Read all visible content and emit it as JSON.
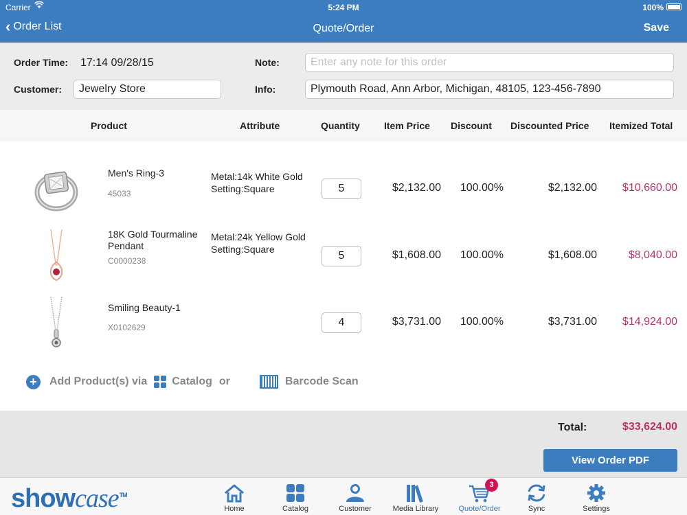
{
  "status_bar": {
    "carrier": "Carrier",
    "time": "5:24 PM",
    "battery": "100%"
  },
  "nav": {
    "back_label": "Order List",
    "title": "Quote/Order",
    "save_label": "Save"
  },
  "form": {
    "order_time_label": "Order Time:",
    "order_time_value": "17:14 09/28/15",
    "note_label": "Note:",
    "note_placeholder": "Enter any note for this order",
    "customer_label": "Customer:",
    "customer_value": "Jewelry Store",
    "info_label": "Info:",
    "info_value": "Plymouth Road, Ann Arbor, Michigan, 48105, 123-456-7890"
  },
  "table": {
    "headers": [
      "Product",
      "Attribute",
      "Quantity",
      "Item Price",
      "Discount",
      "Discounted Price",
      "Itemized Total"
    ],
    "rows": [
      {
        "name": "Men's Ring-3",
        "sku": "45033",
        "attr": "Metal:14k White Gold\nSetting:Square",
        "qty": "5",
        "item_price": "$2,132.00",
        "discount": "100.00%",
        "discounted_price": "$2,132.00",
        "total": "$10,660.00",
        "thumb_icon": "ring-icon"
      },
      {
        "name": "18K Gold Tourmaline Pendant",
        "sku": "C0000238",
        "attr": "Metal:24k Yellow Gold\nSetting:Square",
        "qty": "5",
        "item_price": "$1,608.00",
        "discount": "100.00%",
        "discounted_price": "$1,608.00",
        "total": "$8,040.00",
        "thumb_icon": "pendant-icon"
      },
      {
        "name": "Smiling Beauty-1",
        "sku": "X0102629",
        "attr": "",
        "qty": "4",
        "item_price": "$3,731.00",
        "discount": "100.00%",
        "discounted_price": "$3,731.00",
        "total": "$14,924.00",
        "thumb_icon": "necklace-icon"
      }
    ]
  },
  "add_products": {
    "prefix": "Add Product(s) via",
    "catalog": "Catalog",
    "or": "or",
    "barcode": "Barcode Scan"
  },
  "footer": {
    "total_label": "Total:",
    "total_value": "$33,624.00",
    "pdf_button": "View Order PDF"
  },
  "tabbar": {
    "logo_show": "show",
    "logo_case": "case",
    "logo_tm": "TM",
    "tabs": [
      {
        "label": "Home",
        "icon": "home-icon"
      },
      {
        "label": "Catalog",
        "icon": "catalog-icon"
      },
      {
        "label": "Customer",
        "icon": "customer-icon"
      },
      {
        "label": "Media Library",
        "icon": "media-library-icon"
      },
      {
        "label": "Quote/Order",
        "icon": "cart-icon",
        "badge": "3",
        "active": true
      },
      {
        "label": "Sync",
        "icon": "sync-icon"
      },
      {
        "label": "Settings",
        "icon": "settings-icon"
      }
    ]
  },
  "colors": {
    "primary": "#3c7dbf",
    "accent_total": "#b8336a",
    "badge": "#d0145a"
  }
}
